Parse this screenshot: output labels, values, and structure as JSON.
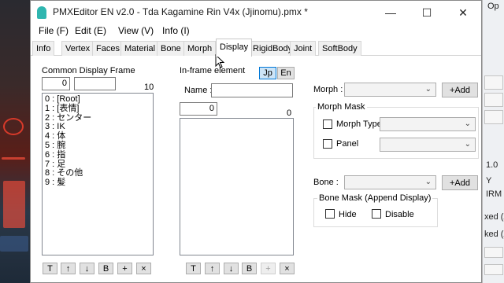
{
  "window": {
    "title": "PMXEditor EN v2.0 - Tda Kagamine Rin V4x (Jjinomu).pmx *",
    "controls": {
      "minimize": "—",
      "maximize": "☐",
      "close": "✕"
    }
  },
  "menu": [
    {
      "label": "File (F)"
    },
    {
      "label": "Edit (E)"
    },
    {
      "label": "View (V)"
    },
    {
      "label": "Info (I)"
    }
  ],
  "tabs": [
    {
      "label": "Info"
    },
    {
      "label": "Vertex"
    },
    {
      "label": "Faces"
    },
    {
      "label": "Material"
    },
    {
      "label": "Bone"
    },
    {
      "label": "Morph"
    },
    {
      "label": "Display",
      "active": true
    },
    {
      "label": "RigidBody"
    },
    {
      "label": "Joint"
    },
    {
      "label": "SoftBody"
    }
  ],
  "display_frame": {
    "heading": "Common Display Frame",
    "index_value": "0",
    "name_value": "",
    "count": "10",
    "items": [
      "0 : [Root]",
      "1 : [表情]",
      "2 : センター",
      "3 : IK",
      "4 : 体",
      "5 : 腕",
      "6 : 指",
      "7 : 足",
      "8 : その他",
      "9 : 髪"
    ],
    "buttons": [
      "T",
      "↑",
      "↓",
      "B",
      "+",
      "×"
    ]
  },
  "inframe": {
    "heading": "In-frame element",
    "lang_jp": "Jp",
    "lang_en": "En",
    "name_label": "Name :",
    "name_value": "",
    "index_value": "0",
    "count": "0",
    "buttons": [
      "T",
      "↑",
      "↓",
      "B",
      "+",
      "×"
    ]
  },
  "morph": {
    "label": "Morph :",
    "selected": "",
    "add_button": "+Add",
    "mask_title": "Morph Mask",
    "morph_type_label": "Morph Type",
    "panel_label": "Panel"
  },
  "bone": {
    "label": "Bone :",
    "selected": "",
    "add_button": "+Add",
    "mask_title": "Bone Mask (Append Display)",
    "hide_label": "Hide",
    "disable_label": "Disable"
  },
  "background_window": {
    "top_label": "Op",
    "right_labels": [
      "1.0",
      "Y",
      "IRM",
      "xed (A",
      "ked (A"
    ]
  },
  "colors": {
    "accent": "#0078d7",
    "toggle_fill": "#cce4f7",
    "app_icon": "#2fb6b0"
  }
}
